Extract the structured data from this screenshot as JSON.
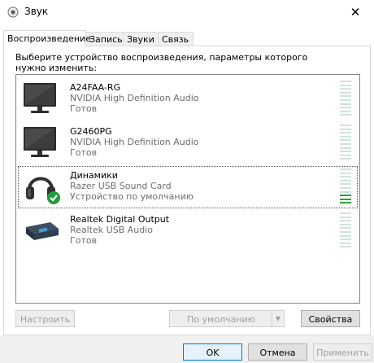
{
  "window": {
    "title": "Звук",
    "close_glyph": "✕"
  },
  "tabs": [
    {
      "label": "Воспроизведение",
      "active": true
    },
    {
      "label": "Запись",
      "active": false
    },
    {
      "label": "Звуки",
      "active": false
    },
    {
      "label": "Связь",
      "active": false
    }
  ],
  "panel": {
    "description": "Выберите устройство воспроизведения, параметры которого нужно изменить:"
  },
  "devices": [
    {
      "name": "A24FAA-RG",
      "driver": "NVIDIA High Definition Audio",
      "status": "Готов",
      "icon": "monitor-icon",
      "level": 0,
      "selected": false
    },
    {
      "name": "G2460PG",
      "driver": "NVIDIA High Definition Audio",
      "status": "Готов",
      "icon": "monitor-icon",
      "level": 0,
      "selected": false
    },
    {
      "name": "Динамики",
      "driver": "Razer USB Sound Card",
      "status": "Устройство по умолчанию",
      "icon": "headset-icon",
      "level": 0.3,
      "selected": true,
      "default": true
    },
    {
      "name": "Realtek Digital Output",
      "driver": "Realtek USB Audio",
      "status": "Готов",
      "icon": "audio-device-icon",
      "level": 0,
      "selected": false
    }
  ],
  "buttons": {
    "configure": "Настроить",
    "set_default": "По умолчанию",
    "properties": "Свойства",
    "ok": "OK",
    "cancel": "Отмена",
    "apply": "Применить"
  },
  "colors": {
    "meter_on": "#2aa63b",
    "meter_off": "#cfe3dd",
    "default_check": "#1e9e3a",
    "focus_border": "#0078d7"
  }
}
